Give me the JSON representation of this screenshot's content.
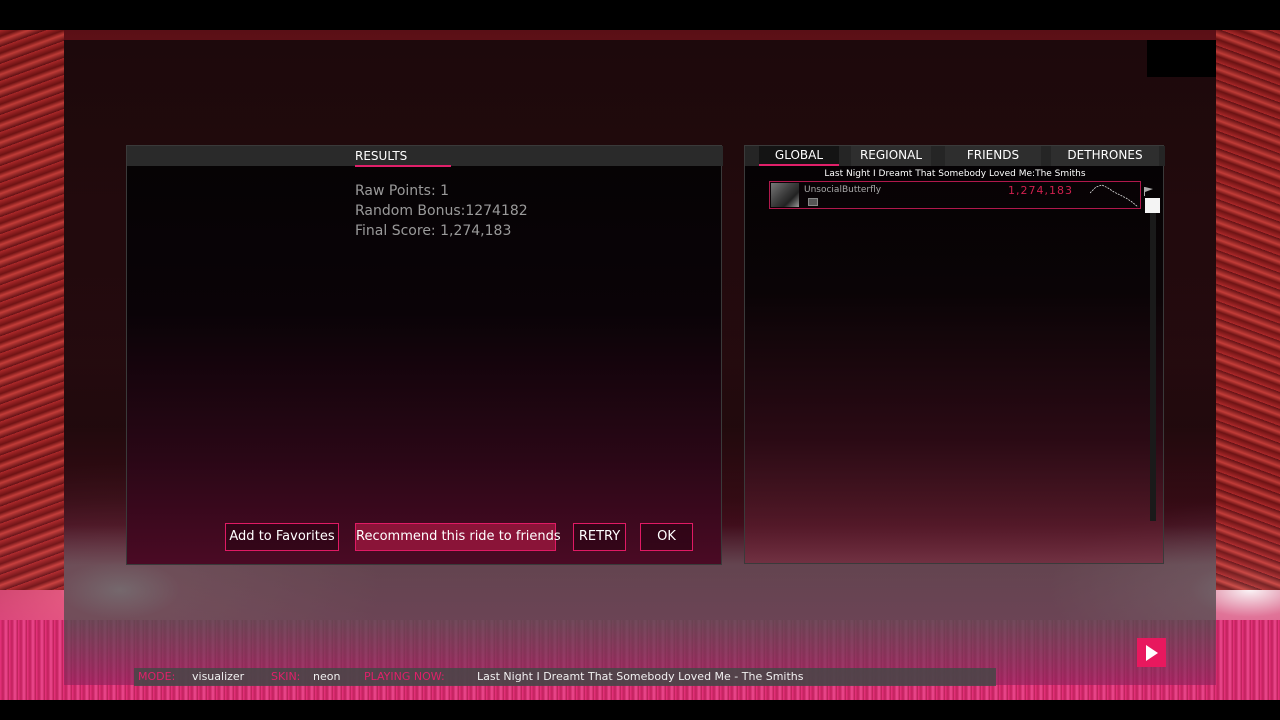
{
  "results": {
    "tab_label": "RESULTS",
    "raw_points": "Raw Points: 1",
    "random_bonus": "Random Bonus:1274182",
    "final_score": "Final Score: 1,274,183",
    "buttons": {
      "favorites": "Add to Favorites",
      "recommend": "Recommend this ride to friends",
      "retry": "RETRY",
      "ok": "OK"
    }
  },
  "leaderboard": {
    "tabs": [
      "GLOBAL",
      "REGIONAL",
      "FRIENDS",
      "DETHRONES"
    ],
    "active_tab": "GLOBAL",
    "song_title": "Last Night I Dreamt That Somebody Loved Me:The Smiths",
    "entries": [
      {
        "name": "UnsocialButterfly",
        "score": "1,274,183"
      }
    ]
  },
  "status_bar": {
    "mode_label": "MODE:",
    "mode_value": "visualizer",
    "skin_label": "SKIN:",
    "skin_value": "neon",
    "playing_label": "PLAYING NOW:",
    "playing_value": "Last Night I Dreamt That Somebody Loved Me - The Smiths"
  },
  "colors": {
    "accent": "#e0206a",
    "panel_header": "#2a2a2a"
  },
  "icons": [
    "play-icon",
    "flag-icon",
    "avatar"
  ]
}
